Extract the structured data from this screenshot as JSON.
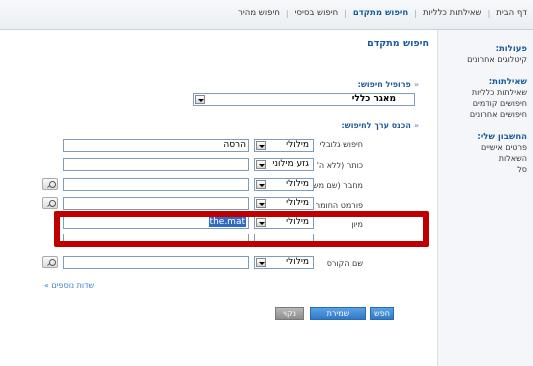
{
  "topnav": {
    "tabs": [
      "חיפוש מהיר",
      "חיפוש בסיסי",
      "חיפוש מתקדם",
      "שאילתות כלליות",
      "דף הבית"
    ],
    "active_index": 2
  },
  "sidebar": {
    "sections": [
      {
        "heading": "פעולות:",
        "items": [
          "קיטלוגים אחרונים"
        ]
      },
      {
        "heading": "שאילתות:",
        "items": [
          "שאילתות כלליות",
          "חיפושים קודמים",
          "חיפושים אחרונים"
        ]
      },
      {
        "heading": "החשבון שלי:",
        "items": [
          "פרטים אישיים",
          "השאלות",
          "סל"
        ]
      }
    ]
  },
  "main": {
    "title": "חיפוש מתקדם",
    "profile_label": "פרופיל חיפוש:",
    "profile_value": "מאגר כללי",
    "values_label": "הכנס ערך לחיפוש:",
    "rows": [
      {
        "label": "חיפוש גלובלי",
        "operator": "מילולי",
        "value": "הרסה",
        "lookup": false
      },
      {
        "label": "כותר (ללא ה' הי...",
        "operator": "גזע מילוני",
        "value": "",
        "lookup": false
      },
      {
        "label": "מחבר (שם משפחה,...",
        "operator": "מילולי",
        "value": "",
        "lookup": true
      },
      {
        "label": "פורמט החומר",
        "operator": "מילולי",
        "value": "",
        "lookup": true
      },
      {
        "label": "מיון",
        "operator": "מילולי",
        "value": "the.mat",
        "lookup": false
      },
      {
        "label": "שם הקורס",
        "operator": "מילולי",
        "value": "",
        "lookup": true
      }
    ],
    "more_fields": "שדות נוספים",
    "buttons": {
      "search": "חפש",
      "save_query": "שמירת שאילתות",
      "clear": "נקוי"
    }
  }
}
